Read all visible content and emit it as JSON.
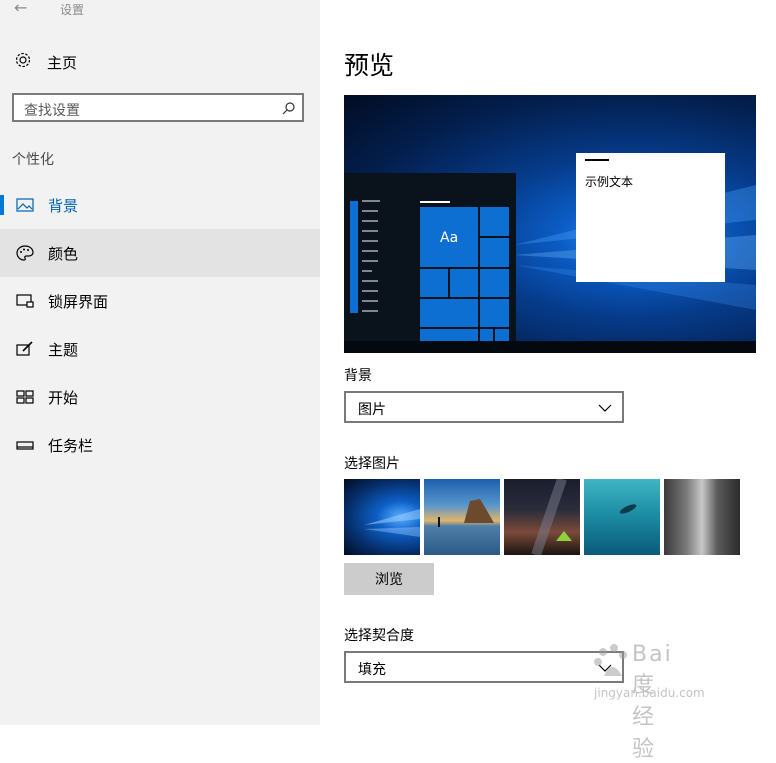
{
  "window": {
    "title": "设置",
    "back_icon": "back-arrow-icon"
  },
  "sidebar": {
    "home_label": "主页",
    "search_placeholder": "查找设置",
    "section_title": "个性化",
    "items": [
      {
        "label": "背景",
        "icon": "picture-icon",
        "active": true
      },
      {
        "label": "颜色",
        "icon": "palette-icon",
        "hovered": true
      },
      {
        "label": "锁屏界面",
        "icon": "lockscreen-icon"
      },
      {
        "label": "主题",
        "icon": "theme-brush-icon"
      },
      {
        "label": "开始",
        "icon": "start-tiles-icon"
      },
      {
        "label": "任务栏",
        "icon": "taskbar-icon"
      }
    ]
  },
  "main": {
    "heading": "预览",
    "preview": {
      "sample_text": "示例文本",
      "tile_text": "Aa"
    },
    "background_label": "背景",
    "background_value": "图片",
    "choose_picture_label": "选择图片",
    "thumbnails": [
      "windows-light-wallpaper",
      "beach-rocks-sunset",
      "milky-way-tent",
      "underwater-swimmer",
      "rock-cliff"
    ],
    "browse_label": "浏览",
    "fit_label": "选择契合度",
    "fit_value": "填充"
  },
  "watermark": {
    "brand": "Bai度 经验",
    "url": "jingyan.baidu.com"
  },
  "colors": {
    "accent": "#0078d7",
    "sidebar_bg": "#f2f2f2",
    "hover_bg": "#e3e3e3"
  }
}
